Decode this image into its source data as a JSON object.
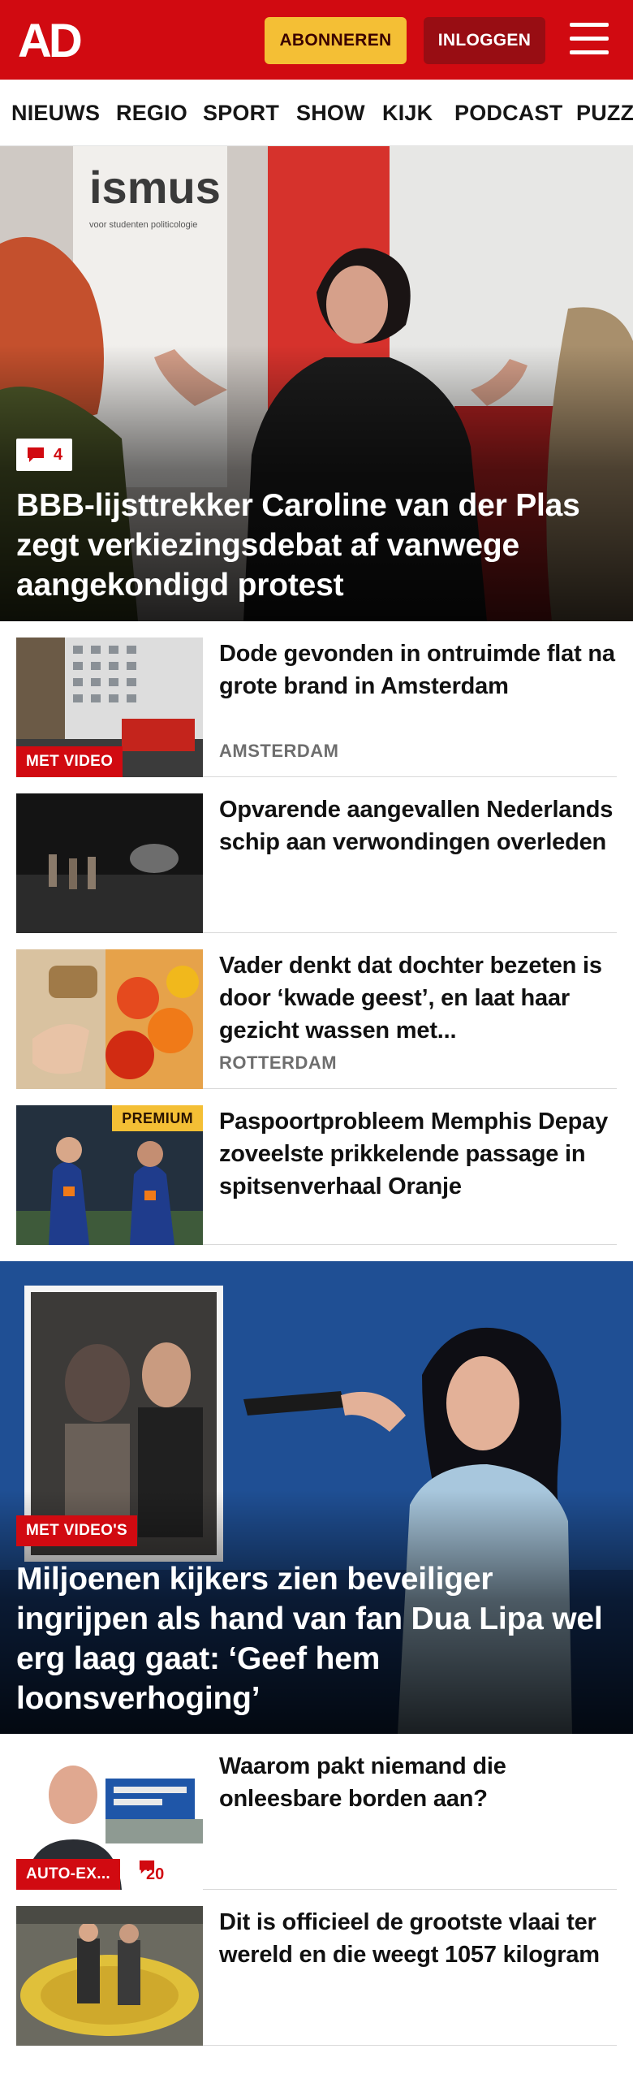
{
  "header": {
    "logo_text": "AD",
    "subscribe_label": "ABONNEREN",
    "login_label": "INLOGGEN",
    "menu_icon": "hamburger-menu-icon"
  },
  "nav": {
    "items": [
      "NIEUWS",
      "REGIO",
      "SPORT",
      "SHOW",
      "KIJK",
      "PODCAST",
      "PUZZ"
    ]
  },
  "hero1": {
    "comment_count": "4",
    "title": "BBB-lijsttrekker Caroline van der Plas zegt verkiezingsdebat af vanwege aangekondigd protest",
    "sign_text": "ismus",
    "sign_subtext": "voor studenten politicologie"
  },
  "articles": [
    {
      "title": "Dode gevonden in ontruimde flat na grote brand in Amsterdam",
      "label": "MET VIDEO",
      "location": "AMSTERDAM"
    },
    {
      "title": "Opvarende aangevallen Nederlands schip aan verwondin­gen overleden"
    },
    {
      "title": "Vader denkt dat dochter bezeten is door ‘kwade geest’, en laat haar gezicht wassen met...",
      "location": "ROTTERDAM"
    },
    {
      "title": "Paspoortprobleem Memphis Depay zoveelste prikkelende passage in spitsenverhaal Oranje",
      "badge": "PREMIUM"
    }
  ],
  "hero2": {
    "label": "MET VIDEO'S",
    "title": "Miljoenen kijkers zien beveiliger ingrijpen als hand van fan Dua Lipa wel erg laag gaat: ‘Geef hem loonsverhoging’"
  },
  "articles2": [
    {
      "title": "Waarom pakt niemand die onleesbare borden aan?",
      "label": "AUTO-EX...",
      "comment_count": "20"
    },
    {
      "title": "Dit is officieel de grootste vlaai ter wereld en die weegt 1057 kilogram"
    }
  ],
  "colors": {
    "brand_red": "#d10a11",
    "subscribe_yellow": "#f4bf35",
    "login_dark_red": "#980d13"
  }
}
